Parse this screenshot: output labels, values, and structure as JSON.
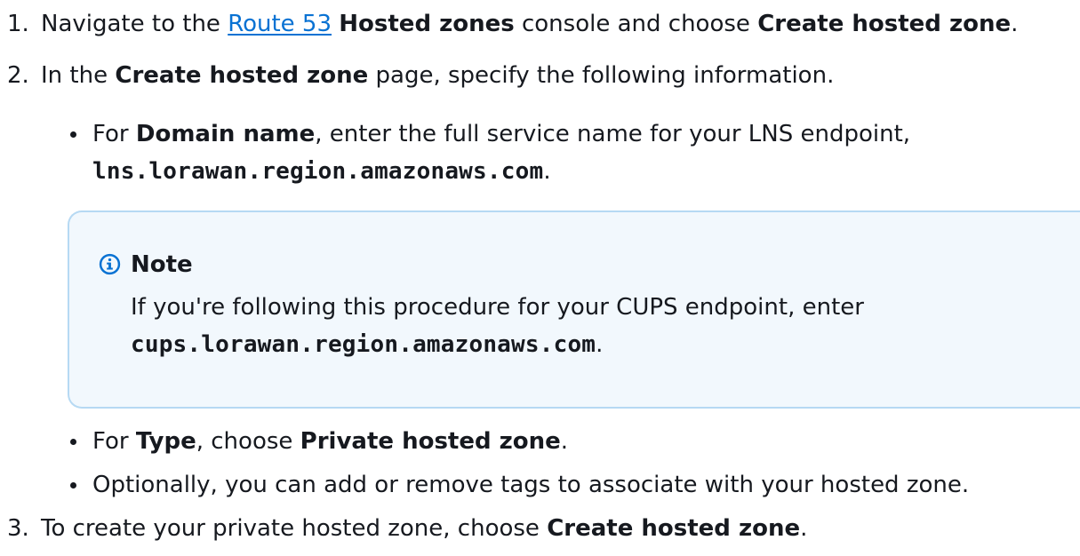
{
  "steps": {
    "step1": {
      "number": "1.",
      "text_before": "Navigate to the ",
      "link": "Route 53",
      "bold1": "Hosted zones",
      "text_mid": " console and choose ",
      "bold2": "Create hosted zone",
      "text_end": "."
    },
    "step2": {
      "number": "2.",
      "text_before": "In the ",
      "bold": "Create hosted zone",
      "text_after": " page, specify the following information.",
      "bullet1": {
        "text_before": "For ",
        "bold": "Domain name",
        "text_after": ", enter the full service name for your LNS endpoint,",
        "code": "lns.lorawan.region.amazonaws.com",
        "text_end": "."
      },
      "note": {
        "icon": "info-icon",
        "title": "Note",
        "text": "If you're following this procedure for your CUPS endpoint, enter",
        "code": "cups.lorawan.region.amazonaws.com",
        "text_end": "."
      },
      "bullet2": {
        "text_before": "For ",
        "bold1": "Type",
        "text_mid": ", choose ",
        "bold2": "Private hosted zone",
        "text_end": "."
      },
      "bullet3": {
        "text": "Optionally, you can add or remove tags to associate with your hosted zone."
      }
    },
    "step3": {
      "number": "3.",
      "text_before": "To create your private hosted zone, choose ",
      "bold": "Create hosted zone",
      "text_end": "."
    }
  },
  "colors": {
    "text": "#16191f",
    "link": "#0972d3",
    "note_background": "#f2f8fd",
    "note_border": "#b6d9f3",
    "info_icon": "#0972d3"
  }
}
